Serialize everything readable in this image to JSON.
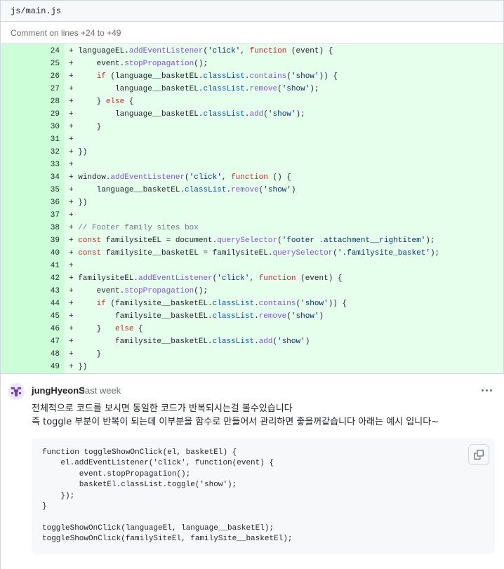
{
  "file": {
    "path": "js/main.js"
  },
  "comment_range": {
    "text": "Comment on lines +24 to +49"
  },
  "diff": {
    "lines": [
      {
        "num": "24",
        "tokens": [
          [
            "",
            "+ languageEL."
          ],
          [
            "f",
            "addEventListener"
          ],
          [
            "",
            "("
          ],
          [
            "s",
            "'click'"
          ],
          [
            "",
            ", "
          ],
          [
            "k",
            "function"
          ],
          [
            "",
            " (event) {"
          ]
        ]
      },
      {
        "num": "25",
        "tokens": [
          [
            "",
            "+     event."
          ],
          [
            "f",
            "stopPropagation"
          ],
          [
            "",
            "();"
          ]
        ]
      },
      {
        "num": "26",
        "tokens": [
          [
            "",
            "+     "
          ],
          [
            "k",
            "if"
          ],
          [
            "",
            " (language__basketEL."
          ],
          [
            "p",
            "classList"
          ],
          [
            "",
            "."
          ],
          [
            "f",
            "contains"
          ],
          [
            "",
            "("
          ],
          [
            "s",
            "'show'"
          ],
          [
            "",
            ")) {"
          ]
        ]
      },
      {
        "num": "27",
        "tokens": [
          [
            "",
            "+         language__basketEL."
          ],
          [
            "p",
            "classList"
          ],
          [
            "",
            "."
          ],
          [
            "f",
            "remove"
          ],
          [
            "",
            "("
          ],
          [
            "s",
            "'show'"
          ],
          [
            "",
            ");"
          ]
        ]
      },
      {
        "num": "28",
        "tokens": [
          [
            "",
            "+     } "
          ],
          [
            "k",
            "else"
          ],
          [
            "",
            " {"
          ]
        ]
      },
      {
        "num": "29",
        "tokens": [
          [
            "",
            "+         language__basketEL."
          ],
          [
            "p",
            "classList"
          ],
          [
            "",
            "."
          ],
          [
            "f",
            "add"
          ],
          [
            "",
            "("
          ],
          [
            "s",
            "'show'"
          ],
          [
            "",
            ");"
          ]
        ]
      },
      {
        "num": "30",
        "tokens": [
          [
            "",
            "+     }"
          ]
        ]
      },
      {
        "num": "31",
        "tokens": [
          [
            "",
            "+"
          ]
        ]
      },
      {
        "num": "32",
        "tokens": [
          [
            "",
            "+ })"
          ]
        ]
      },
      {
        "num": "33",
        "tokens": [
          [
            "",
            "+"
          ]
        ]
      },
      {
        "num": "34",
        "tokens": [
          [
            "",
            "+ window."
          ],
          [
            "f",
            "addEventListener"
          ],
          [
            "",
            "("
          ],
          [
            "s",
            "'click'"
          ],
          [
            "",
            ", "
          ],
          [
            "k",
            "function"
          ],
          [
            "",
            " () {"
          ]
        ]
      },
      {
        "num": "35",
        "tokens": [
          [
            "",
            "+     language__basketEL."
          ],
          [
            "p",
            "classList"
          ],
          [
            "",
            "."
          ],
          [
            "f",
            "remove"
          ],
          [
            "",
            "("
          ],
          [
            "s",
            "'show'"
          ],
          [
            "",
            ")"
          ]
        ]
      },
      {
        "num": "36",
        "tokens": [
          [
            "",
            "+ })"
          ]
        ]
      },
      {
        "num": "37",
        "tokens": [
          [
            "",
            "+"
          ]
        ]
      },
      {
        "num": "38",
        "tokens": [
          [
            "",
            "+ "
          ],
          [
            "cm",
            "// Footer family sites box"
          ]
        ]
      },
      {
        "num": "39",
        "tokens": [
          [
            "",
            "+ "
          ],
          [
            "k",
            "const"
          ],
          [
            "",
            " familysiteEL = document."
          ],
          [
            "f",
            "querySelector"
          ],
          [
            "",
            "("
          ],
          [
            "s",
            "'footer .attachment__rightitem'"
          ],
          [
            "",
            ");"
          ]
        ]
      },
      {
        "num": "40",
        "tokens": [
          [
            "",
            "+ "
          ],
          [
            "k",
            "const"
          ],
          [
            "",
            " familysite__basketEL = familysiteEL."
          ],
          [
            "f",
            "querySelector"
          ],
          [
            "",
            "("
          ],
          [
            "s",
            "'.familysite_basket'"
          ],
          [
            "",
            ");"
          ]
        ]
      },
      {
        "num": "41",
        "tokens": [
          [
            "",
            "+"
          ]
        ]
      },
      {
        "num": "42",
        "tokens": [
          [
            "",
            "+ familysiteEL."
          ],
          [
            "f",
            "addEventListener"
          ],
          [
            "",
            "("
          ],
          [
            "s",
            "'click'"
          ],
          [
            "",
            ", "
          ],
          [
            "k",
            "function"
          ],
          [
            "",
            " (event) {"
          ]
        ]
      },
      {
        "num": "43",
        "tokens": [
          [
            "",
            "+     event."
          ],
          [
            "f",
            "stopPropagation"
          ],
          [
            "",
            "();"
          ]
        ]
      },
      {
        "num": "44",
        "tokens": [
          [
            "",
            "+     "
          ],
          [
            "k",
            "if"
          ],
          [
            "",
            " (familysite__basketEL."
          ],
          [
            "p",
            "classList"
          ],
          [
            "",
            "."
          ],
          [
            "f",
            "contains"
          ],
          [
            "",
            "("
          ],
          [
            "s",
            "'show'"
          ],
          [
            "",
            ")) {"
          ]
        ]
      },
      {
        "num": "45",
        "tokens": [
          [
            "",
            "+         familysite__basketEL."
          ],
          [
            "p",
            "classList"
          ],
          [
            "",
            "."
          ],
          [
            "f",
            "remove"
          ],
          [
            "",
            "("
          ],
          [
            "s",
            "'show'"
          ],
          [
            "",
            ")"
          ]
        ]
      },
      {
        "num": "46",
        "tokens": [
          [
            "",
            "+     }   "
          ],
          [
            "k",
            "else"
          ],
          [
            "",
            " {"
          ]
        ]
      },
      {
        "num": "47",
        "tokens": [
          [
            "",
            "+         familysite__basketEL."
          ],
          [
            "p",
            "classList"
          ],
          [
            "",
            "."
          ],
          [
            "f",
            "add"
          ],
          [
            "",
            "("
          ],
          [
            "s",
            "'show'"
          ],
          [
            "",
            ")"
          ]
        ]
      },
      {
        "num": "48",
        "tokens": [
          [
            "",
            "+     }"
          ]
        ]
      },
      {
        "num": "49",
        "tokens": [
          [
            "",
            "+ })"
          ]
        ]
      }
    ]
  },
  "comment": {
    "author": "jungHyeonS",
    "timestamp": "last week",
    "avatar_icon": "identicon-avatar",
    "menu_icon": "kebab-horizontal-icon",
    "body_lines": [
      "전체적으로 코드를 보시면 동일한 코드가 반복되시는걸 볼수있습니다",
      "즉 toggle 부분이 반복이 되는데 이부분을 함수로 만들어서 관리하면 좋을꺼같습니다 아래는 예시 입니다~"
    ],
    "code_sample": "function toggleShowOnClick(el, basketEl) {\n    el.addEventListener('click', function(event) {\n        event.stopPropagation();\n        basketEl.classList.toggle('show');\n    });\n}\n\ntoggleShowOnClick(languageEl, language__basketEl);\ntoggleShowOnClick(familySiteEl, familySite__basketEl);",
    "copy_icon": "copy-icon"
  },
  "colors": {
    "diff_line_number_bg": "#ccffd8",
    "diff_code_bg": "#e6ffec",
    "code_block_bg": "#f6f8fa",
    "avatar_color": "#6f42c1"
  }
}
